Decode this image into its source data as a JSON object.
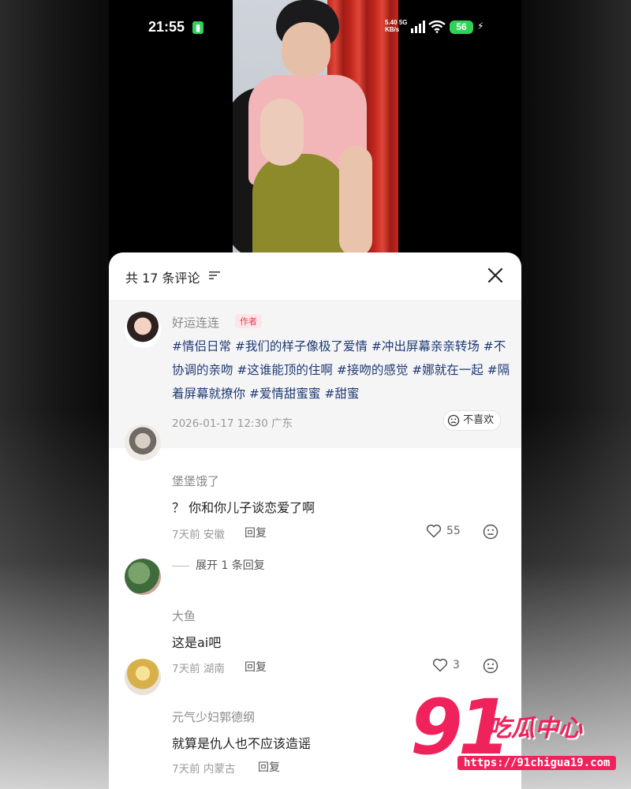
{
  "status_bar": {
    "time": "21:55",
    "net_speed": "5.40",
    "net_unit": "KB/s",
    "network_type": "5G",
    "battery": "56"
  },
  "comments_sheet": {
    "title": "共 17 条评论",
    "author_post": {
      "username": "好运连连",
      "tag": "作者",
      "text": "#情侣日常 #我们的样子像极了爱情 #冲出屏幕亲亲转场 #不协调的亲吻 #这谁能顶的住啊 #接吻的感觉 #娜就在一起 #隔着屏幕就撩你 #爱情甜蜜蜜 #甜蜜",
      "meta": "2026-01-17 12:30 广东",
      "dislike_label": "不喜欢"
    },
    "comments": [
      {
        "username": "堡堡饿了",
        "text": "？ 你和你儿子谈恋爱了啊",
        "meta": "7天前 安徽",
        "reply": "回复",
        "likes": "55",
        "expand": "展开 1 条回复"
      },
      {
        "username": "大鱼",
        "text": "这是ai吧",
        "meta": "7天前 湖南",
        "reply": "回复",
        "likes": "3"
      },
      {
        "username": "元气少妇郭德纲",
        "text": "就算是仇人也不应该造谣",
        "meta": "7天前 内蒙古",
        "reply": "回复"
      }
    ]
  },
  "watermark": {
    "number": "91",
    "text": "吃瓜中心",
    "url": "https://91chigua19.com"
  },
  "colors": {
    "accent_pink": "#f0225c",
    "hashtag_blue": "#1e3a73",
    "battery_green": "#2fd157"
  }
}
